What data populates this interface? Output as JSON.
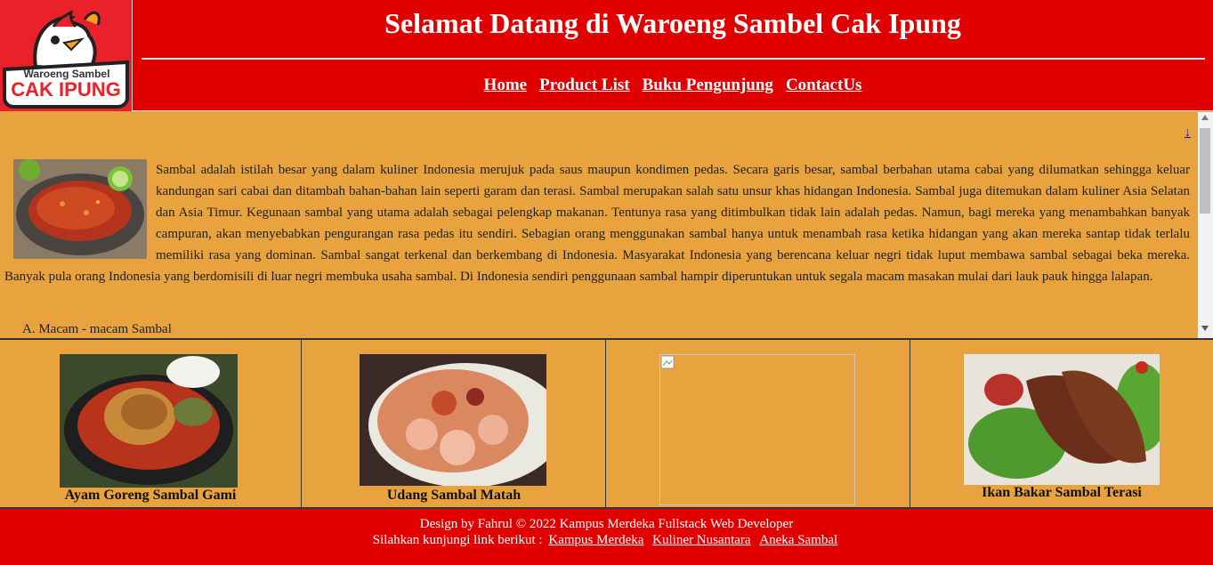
{
  "header": {
    "logo_text_top": "Waroeng Sambel",
    "logo_text_bottom": "CAK IPUNG",
    "title": "Selamat Datang di Waroeng Sambel Cak Ipung",
    "nav": [
      "Home",
      "Product List",
      "Buku Pengunjung",
      "ContactUs"
    ]
  },
  "content": {
    "top_link": "↓",
    "article_text": "Sambal adalah istilah besar yang dalam kuliner Indonesia merujuk pada saus maupun kondimen pedas. Secara garis besar, sambal berbahan utama cabai yang dilumatkan sehingga keluar kandungan sari cabai dan ditambah bahan-bahan lain seperti garam dan terasi. Sambal merupakan salah satu unsur khas hidangan Indonesia. Sambal juga ditemukan dalam kuliner Asia Selatan dan Asia Timur. Kegunaan sambal yang utama adalah sebagai pelengkap makanan. Tentunya rasa yang ditimbulkan tidak lain adalah pedas. Namun, bagi mereka yang menambahkan banyak campuran, akan menyebabkan pengurangan rasa pedas itu sendiri. Sebagian orang menggunakan sambal hanya untuk menambah rasa ketika hidangan yang akan mereka santap tidak terlalu memiliki rasa yang dominan. Sambal sangat terkenal dan berkembang di Indonesia. Masyarakat Indonesia yang berencana keluar negri tidak luput membawa sambal sebagai beka mereka. Banyak pula orang Indonesia yang berdomisili di luar negri membuka usaha sambal. Di Indonesia sendiri penggunaan sambal hampir diperuntukan untuk segala macam masakan mulai dari lauk pauk hingga lalapan.",
    "section_heading": "A. Macam - macam Sambal"
  },
  "gallery": [
    {
      "caption": "Ayam Goreng Sambal Gami"
    },
    {
      "caption": "Udang Sambal Matah"
    },
    {
      "caption": ""
    },
    {
      "caption": "Ikan Bakar Sambal Terasi"
    }
  ],
  "footer": {
    "line1": "Design by Fahrul © 2022 Kampus Merdeka Fullstack Web Developer",
    "line2_prefix": "Silahkan kunjungi link berikut :",
    "links": [
      "Kampus Merdeka",
      "Kuliner Nusantara",
      "Aneka Sambal"
    ]
  }
}
